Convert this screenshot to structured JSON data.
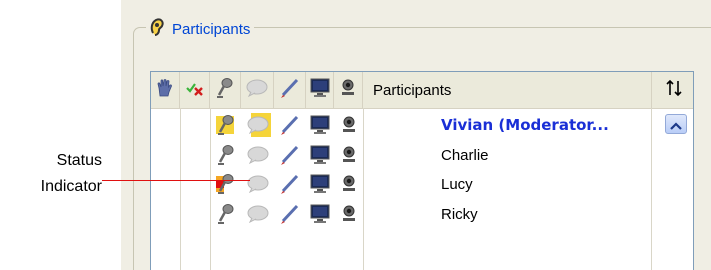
{
  "groupbox": {
    "title": "Participants"
  },
  "grid": {
    "name_column_header": "Participants",
    "columns": [
      {
        "icon": "raise-hand-icon"
      },
      {
        "icon": "approve-deny-icon"
      },
      {
        "icon": "microphone-icon"
      },
      {
        "icon": "chat-bubble-icon"
      },
      {
        "icon": "annotate-pen-icon"
      },
      {
        "icon": "desktop-share-icon"
      },
      {
        "icon": "webcam-icon"
      }
    ],
    "sort_icon": "sort-arrows-icon",
    "rows": [
      {
        "name": "Vivian (Moderator...",
        "moderator": true
      },
      {
        "name": "Charlie",
        "moderator": false
      },
      {
        "name": "Lucy",
        "moderator": false,
        "status_indicator": true
      },
      {
        "name": "Ricky",
        "moderator": false
      }
    ]
  },
  "callout": {
    "line1": "Status",
    "line2": "Indicator",
    "color": "#e01010"
  },
  "colors": {
    "accent": "#0046d5",
    "moderator": "#1a2fd6",
    "header_bg": "#ebeadb",
    "panel_bg": "#f0eee4"
  }
}
